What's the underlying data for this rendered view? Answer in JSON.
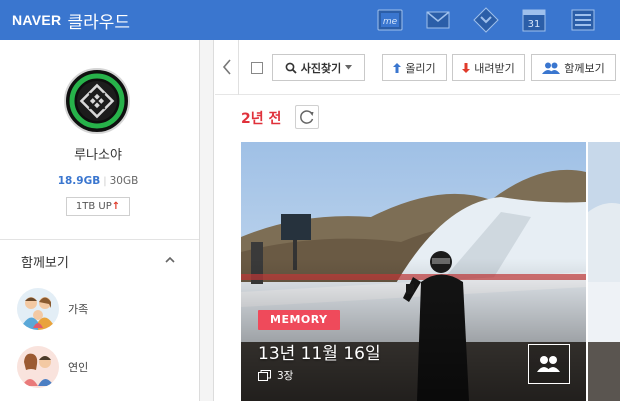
{
  "header": {
    "brand": "NAVER",
    "app_name": "클라우드",
    "bg_color": "#3a76cf",
    "icons": [
      "memo-icon",
      "mail-icon",
      "bookmark-icon",
      "calendar-icon",
      "list-icon"
    ],
    "calendar_day": "31",
    "memo_text": "me"
  },
  "sidebar": {
    "user_name": "루나소야",
    "storage_used": "18.9GB",
    "storage_total": "30GB",
    "upgrade_label": "1TB UP",
    "upgrade_arrow": "↑",
    "section_title": "함께보기",
    "members": [
      {
        "label": "가족",
        "icon": "family-avatar-icon"
      },
      {
        "label": "연인",
        "icon": "couple-avatar-icon"
      }
    ]
  },
  "toolbar": {
    "search_label": "사진찾기",
    "upload_label": "올리기",
    "download_label": "내려받기",
    "share_label": "함께보기"
  },
  "content": {
    "period_label": "2년 전",
    "card": {
      "badge": "MEMORY",
      "date": "13년 11월 16일",
      "count": "3장"
    }
  },
  "colors": {
    "accent_blue": "#3a76cf",
    "accent_red": "#e0313b",
    "badge_pink": "#ef4a5b"
  }
}
